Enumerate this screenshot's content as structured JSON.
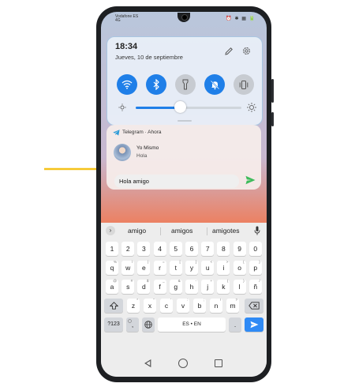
{
  "status_bar": {
    "carrier_line1": "Vodafone ES",
    "carrier_line2": "4G",
    "icons": "⏰ ✱ ▦ 🔋"
  },
  "quick_settings": {
    "time": "18:34",
    "date": "Jueves, 10 de septiembre",
    "toggles": [
      {
        "name": "wifi-toggle",
        "icon": "wifi-icon",
        "state": "on"
      },
      {
        "name": "bluetooth-toggle",
        "icon": "bluetooth-icon",
        "state": "on"
      },
      {
        "name": "flashlight-toggle",
        "icon": "flashlight-icon",
        "state": "off"
      },
      {
        "name": "mute-toggle",
        "icon": "bell-off-icon",
        "state": "on"
      },
      {
        "name": "vibrate-toggle",
        "icon": "vibrate-icon",
        "state": "off"
      }
    ],
    "brightness_level": 0.42
  },
  "notification": {
    "app": "Telegram",
    "time": "Ahora",
    "sender": "Yo Mismo",
    "message": "Hola",
    "reply_value": "Hola amigo"
  },
  "keyboard": {
    "suggestions": [
      "amigo",
      "amigos",
      "amigotes"
    ],
    "row1": [
      "1",
      "2",
      "3",
      "4",
      "5",
      "6",
      "7",
      "8",
      "9",
      "0"
    ],
    "row2": [
      "q",
      "w",
      "e",
      "r",
      "t",
      "y",
      "u",
      "i",
      "o",
      "p"
    ],
    "row2_sub": [
      "%",
      "\\",
      "|",
      "=",
      "[",
      "]",
      "<",
      ">",
      "{",
      "}"
    ],
    "row3": [
      "a",
      "s",
      "d",
      "f",
      "g",
      "h",
      "j",
      "k",
      "l",
      "ñ"
    ],
    "row3_sub": [
      "@",
      "#",
      "$",
      "_",
      "&",
      "-",
      "+",
      "(",
      ")",
      "/"
    ],
    "row4": [
      "z",
      "x",
      "c",
      "v",
      "b",
      "n",
      "m"
    ],
    "row4_sub": [
      "*",
      "\"",
      "'",
      ":",
      ";",
      "!",
      "?"
    ],
    "symbols_key": "?123",
    "comma_key": ",",
    "space_label": "ES • EN",
    "period_key": "."
  },
  "colors": {
    "accent": "#1f7fe8",
    "send_green": "#3dbb5a",
    "arrow_yellow": "#f5c21a"
  }
}
